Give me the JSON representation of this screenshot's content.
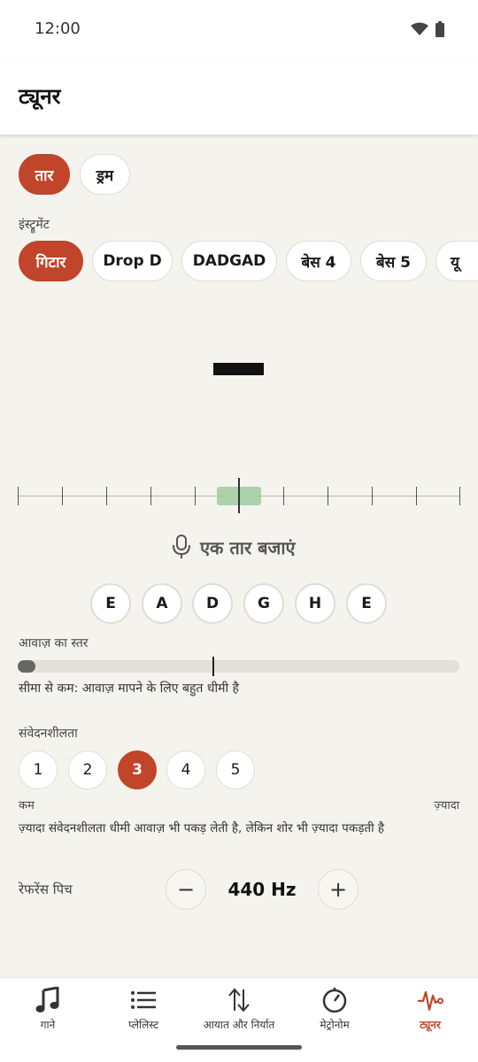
{
  "status": {
    "time": "12:00",
    "wifi_icon": "wifi-icon",
    "battery_icon": "battery-icon"
  },
  "appbar": {
    "title": "ट्यूनर"
  },
  "mode_tabs": [
    {
      "label": "तार",
      "active": true
    },
    {
      "label": "ड्रम",
      "active": false
    }
  ],
  "instrument": {
    "label": "इंस्ट्रूमेंट",
    "chips": [
      {
        "label": "गिटार",
        "active": true
      },
      {
        "label": "Drop D",
        "active": false
      },
      {
        "label": "DADGAD",
        "active": false
      },
      {
        "label": "बेस 4",
        "active": false
      },
      {
        "label": "बेस 5",
        "active": false
      },
      {
        "label": "यू",
        "active": false
      }
    ]
  },
  "tuner": {
    "reading": "—",
    "prompt": "एक तार बजाएं",
    "prompt_icon": "microphone-icon",
    "strings": [
      "E",
      "A",
      "D",
      "G",
      "H",
      "E"
    ]
  },
  "volume": {
    "label": "आवाज़ का स्तर",
    "level": 0.04,
    "threshold": 0.44,
    "message": "सीमा से कम: आवाज़ मापने के लिए बहुत धीमी है"
  },
  "sensitivity": {
    "label": "संवेदनशीलता",
    "options": [
      "1",
      "2",
      "3",
      "4",
      "5"
    ],
    "selected": "3",
    "low_label": "कम",
    "high_label": "ज़्यादा",
    "hint": "ज़्यादा संवेदनशीलता धीमी आवाज़ भी पकड़ लेती है, लेकिन शोर भी ज़्यादा पकड़ती है"
  },
  "reference": {
    "label": "रेफरेंस पिच",
    "value": "440 Hz",
    "minus": "−",
    "plus": "+"
  },
  "nav": [
    {
      "label": "गाने",
      "icon": "music-note-icon",
      "active": false
    },
    {
      "label": "प्लेलिस्ट",
      "icon": "list-icon",
      "active": false
    },
    {
      "label": "आयात और निर्यात",
      "icon": "import-export-icon",
      "active": false
    },
    {
      "label": "मेट्रोनोम",
      "icon": "metronome-icon",
      "active": false
    },
    {
      "label": "ट्यूनर",
      "icon": "tuner-wave-icon",
      "active": true
    }
  ],
  "colors": {
    "accent": "#c0452a",
    "background": "#f5f3ee",
    "in_tune_zone": "#9ecb9f"
  }
}
